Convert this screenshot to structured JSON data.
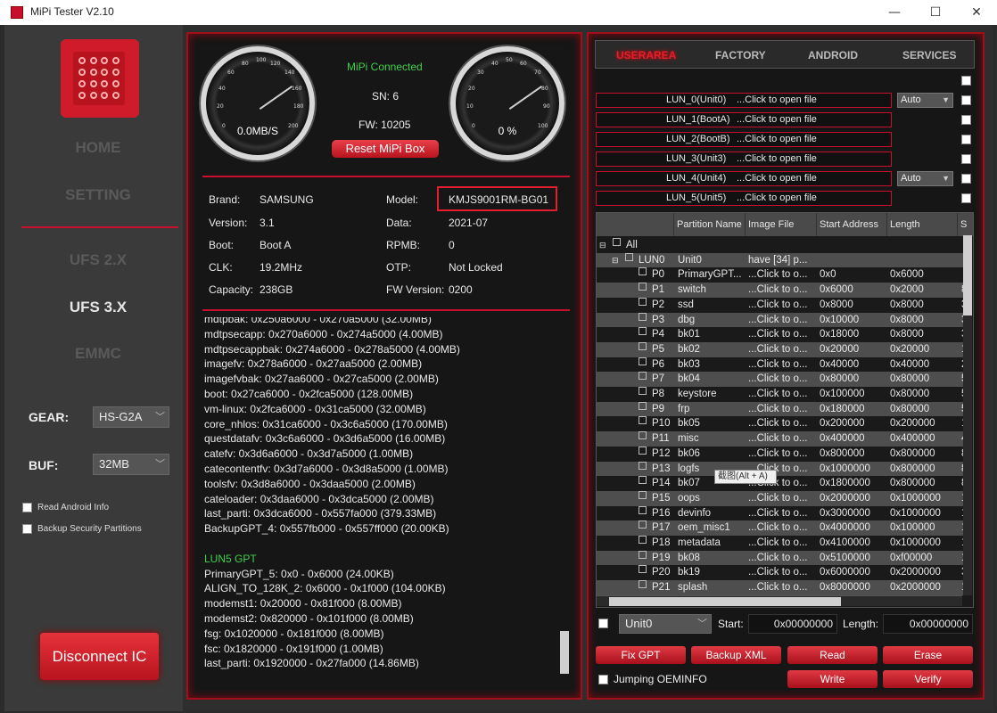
{
  "window": {
    "title": "MiPi Tester V2.10",
    "min": "—",
    "max": "☐",
    "close": "✕"
  },
  "nav": {
    "home": "HOME",
    "setting": "SETTING",
    "ufs2": "UFS 2.X",
    "ufs3": "UFS 3.X",
    "emmc": "EMMC"
  },
  "left": {
    "gear_label": "GEAR:",
    "gear_value": "HS-G2A",
    "buf_label": "BUF:",
    "buf_value": "32MB",
    "read_android": "Read Android Info",
    "backup_security": "Backup Security Partitions",
    "disconnect": "Disconnect IC"
  },
  "status": {
    "connected": "MiPi Connected",
    "sn": "SN: 6",
    "fw": "FW: 10205",
    "reset": "Reset MiPi Box",
    "speed": "0.0MB/S",
    "percent": "0 %"
  },
  "gauge_ticks": {
    "speed": [
      "0",
      "20",
      "40",
      "60",
      "80",
      "100",
      "120",
      "140",
      "160",
      "180",
      "200"
    ],
    "pct": [
      "0",
      "10",
      "20",
      "30",
      "40",
      "50",
      "60",
      "70",
      "80",
      "90",
      "100"
    ]
  },
  "device": {
    "brand_label": "Brand:",
    "brand": "SAMSUNG",
    "model_label": "Model:",
    "model": "KMJS9001RM-BG01",
    "version_label": "Version:",
    "version": "3.1",
    "data_label": "Data:",
    "data": "2021-07",
    "boot_label": "Boot:",
    "boot": "Boot A",
    "rpmb_label": "RPMB:",
    "rpmb": "0",
    "clk_label": "CLK:",
    "clk": "19.2MHz",
    "otp_label": "OTP:",
    "otp": "Not Locked",
    "capacity_label": "Capacity:",
    "capacity": "238GB",
    "fwver_label": "FW Version:",
    "fwver": "0200"
  },
  "log": [
    "mdtpbak: 0x250a6000 - 0x270a5000 (32.00MB)",
    "mdtpsecapp: 0x270a6000 - 0x274a5000 (4.00MB)",
    "mdtpsecappbak: 0x274a6000 - 0x278a5000 (4.00MB)",
    "imagefv: 0x278a6000 - 0x27aa5000 (2.00MB)",
    "imagefvbak: 0x27aa6000 - 0x27ca5000 (2.00MB)",
    "boot: 0x27ca6000 - 0x2fca5000 (128.00MB)",
    "vm-linux: 0x2fca6000 - 0x31ca5000 (32.00MB)",
    "core_nhlos: 0x31ca6000 - 0x3c6a5000 (170.00MB)",
    "questdatafv: 0x3c6a6000 - 0x3d6a5000 (16.00MB)",
    "catefv: 0x3d6a6000 - 0x3d7a5000 (1.00MB)",
    "catecontentfv: 0x3d7a6000 - 0x3d8a5000 (1.00MB)",
    "toolsfv: 0x3d8a6000 - 0x3daa5000 (2.00MB)",
    "cateloader: 0x3daa6000 - 0x3dca5000 (2.00MB)",
    "last_parti: 0x3dca6000 - 0x557fa000 (379.33MB)",
    "BackupGPT_4: 0x557fb000 - 0x557ff000 (20.00KB)",
    "",
    "LUN5 GPT",
    "PrimaryGPT_5: 0x0 - 0x6000 (24.00KB)",
    "ALIGN_TO_128K_2: 0x6000 - 0x1f000 (104.00KB)",
    "modemst1: 0x20000 - 0x81f000 (8.00MB)",
    "modemst2: 0x820000 - 0x101f000 (8.00MB)",
    "fsg: 0x1020000 - 0x181f000 (8.00MB)",
    "fsc: 0x1820000 - 0x191f000 (1.00MB)",
    "last_parti: 0x1920000 - 0x27fa000 (14.86MB)"
  ],
  "tabs": [
    "USERAREA",
    "FACTORY",
    "ANDROID",
    "SERVICES"
  ],
  "luns": [
    {
      "name": "LUN_0(Unit0)",
      "click": "...Click to open file"
    },
    {
      "name": "LUN_1(BootA)",
      "click": "...Click to open file"
    },
    {
      "name": "LUN_2(BootB)",
      "click": "...Click to open file"
    },
    {
      "name": "LUN_3(Unit3)",
      "click": "...Click to open file"
    },
    {
      "name": "LUN_4(Unit4)",
      "click": "...Click to open file"
    },
    {
      "name": "LUN_5(Unit5)",
      "click": "...Click to open file"
    }
  ],
  "auto0": "Auto",
  "auto4": "Auto",
  "grid": {
    "headers": [
      "Partition Name",
      "Image File",
      "Start Address",
      "Length",
      "S"
    ],
    "all": "All",
    "lun": "LUN0",
    "unit": "Unit0",
    "have": "have [34] p...",
    "rows": [
      {
        "p": "P0",
        "name": "PrimaryGPT...",
        "img": "...Click to o...",
        "start": "0x0",
        "len": "0x6000",
        "s": ""
      },
      {
        "p": "P1",
        "name": "switch",
        "img": "...Click to o...",
        "start": "0x6000",
        "len": "0x2000",
        "s": "8"
      },
      {
        "p": "P2",
        "name": "ssd",
        "img": "...Click to o...",
        "start": "0x8000",
        "len": "0x8000",
        "s": "3"
      },
      {
        "p": "P3",
        "name": "dbg",
        "img": "...Click to o...",
        "start": "0x10000",
        "len": "0x8000",
        "s": "3"
      },
      {
        "p": "P4",
        "name": "bk01",
        "img": "...Click to o...",
        "start": "0x18000",
        "len": "0x8000",
        "s": "3"
      },
      {
        "p": "P5",
        "name": "bk02",
        "img": "...Click to o...",
        "start": "0x20000",
        "len": "0x20000",
        "s": "1"
      },
      {
        "p": "P6",
        "name": "bk03",
        "img": "...Click to o...",
        "start": "0x40000",
        "len": "0x40000",
        "s": "2"
      },
      {
        "p": "P7",
        "name": "bk04",
        "img": "...Click to o...",
        "start": "0x80000",
        "len": "0x80000",
        "s": "5"
      },
      {
        "p": "P8",
        "name": "keystore",
        "img": "...Click to o...",
        "start": "0x100000",
        "len": "0x80000",
        "s": "5"
      },
      {
        "p": "P9",
        "name": "frp",
        "img": "...Click to o...",
        "start": "0x180000",
        "len": "0x80000",
        "s": "5"
      },
      {
        "p": "P10",
        "name": "bk05",
        "img": "...Click to o...",
        "start": "0x200000",
        "len": "0x200000",
        "s": "1"
      },
      {
        "p": "P11",
        "name": "misc",
        "img": "...Click to o...",
        "start": "0x400000",
        "len": "0x400000",
        "s": "4"
      },
      {
        "p": "P12",
        "name": "bk06",
        "img": "...Click to o...",
        "start": "0x800000",
        "len": "0x800000",
        "s": "8"
      },
      {
        "p": "P13",
        "name": "logfs",
        "img": "...Click to o...",
        "start": "0x1000000",
        "len": "0x800000",
        "s": "8"
      },
      {
        "p": "P14",
        "name": "bk07",
        "img": "...Click to o...",
        "start": "0x1800000",
        "len": "0x800000",
        "s": "8"
      },
      {
        "p": "P15",
        "name": "oops",
        "img": "...Click to o...",
        "start": "0x2000000",
        "len": "0x1000000",
        "s": "1"
      },
      {
        "p": "P16",
        "name": "devinfo",
        "img": "...Click to o...",
        "start": "0x3000000",
        "len": "0x1000000",
        "s": "1"
      },
      {
        "p": "P17",
        "name": "oem_misc1",
        "img": "...Click to o...",
        "start": "0x4000000",
        "len": "0x100000",
        "s": "1"
      },
      {
        "p": "P18",
        "name": "metadata",
        "img": "...Click to o...",
        "start": "0x4100000",
        "len": "0x1000000",
        "s": "1"
      },
      {
        "p": "P19",
        "name": "bk08",
        "img": "...Click to o...",
        "start": "0x5100000",
        "len": "0xf00000",
        "s": "1"
      },
      {
        "p": "P20",
        "name": "bk19",
        "img": "...Click to o...",
        "start": "0x6000000",
        "len": "0x2000000",
        "s": "3"
      },
      {
        "p": "P21",
        "name": "splash",
        "img": "...Click to o...",
        "start": "0x8000000",
        "len": "0x2000000",
        "s": "1"
      }
    ]
  },
  "tooltip": "截图(Alt + A)",
  "bottom": {
    "unit": "Unit0",
    "start_label": "Start:",
    "start": "0x00000000",
    "length_label": "Length:",
    "length": "0x00000000",
    "fixgpt": "Fix GPT",
    "backupxml": "Backup XML",
    "read": "Read",
    "erase": "Erase",
    "jumping": "Jumping OEMINFO",
    "write": "Write",
    "verify": "Verify"
  },
  "colors": {
    "accent": "#c8102e",
    "connected": "#3fd14a"
  }
}
